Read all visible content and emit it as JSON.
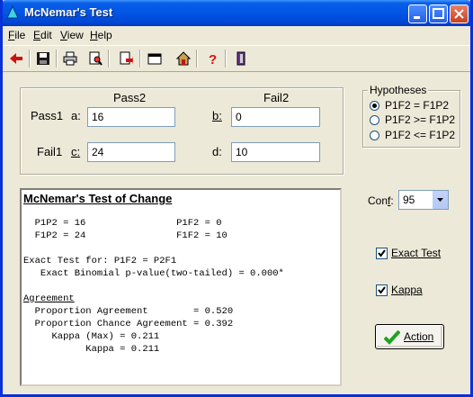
{
  "window": {
    "title": "McNemar's Test",
    "icon": "tree-icon"
  },
  "menu": [
    {
      "label": "File",
      "accel": "F"
    },
    {
      "label": "Edit",
      "accel": "E"
    },
    {
      "label": "View",
      "accel": "V"
    },
    {
      "label": "Help",
      "accel": "H"
    }
  ],
  "toolbar": [
    "back-arrow-icon",
    "save-icon",
    "print-icon",
    "print-preview-icon",
    "export-icon",
    "window-icon",
    "home-icon",
    "help-icon",
    "exit-icon"
  ],
  "table": {
    "col1": "Pass2",
    "col2": "Fail2",
    "row1": "Pass1",
    "row2": "Fail1",
    "a_label": "a:",
    "a_value": "16",
    "b_label": "b:",
    "b_value": "0",
    "c_label": "c:",
    "c_value": "24",
    "d_label": "d:",
    "d_value": "10"
  },
  "hypotheses": {
    "title": "Hypotheses",
    "options": [
      "P1F2 = F1P2",
      "P1F2 >= F1P2",
      "P1F2 <= F1P2"
    ],
    "selected": 0
  },
  "output": {
    "heading": "McNemar's Test of Change",
    "lines": [
      "  P1P2 = 16                P1F2 = 0",
      "  F1P2 = 24                F1F2 = 10",
      "",
      "Exact Test for: P1F2 = P2F1",
      "   Exact Binomial p-value(two-tailed) = 0.000*",
      ""
    ],
    "agreement_heading": "Agreement",
    "agreement_lines": [
      "  Proportion Agreement        = 0.520",
      "  Proportion Chance Agreement = 0.392",
      "     Kappa (Max) = 0.211",
      "           Kappa = 0.211"
    ]
  },
  "conf": {
    "label": "Conf:",
    "value": "95"
  },
  "exact_test": {
    "label": "Exact Test",
    "checked": true
  },
  "kappa": {
    "label": "Kappa",
    "checked": true
  },
  "action": {
    "label": "Action"
  },
  "colors": {
    "titlebar": "#0055e5",
    "face": "#ece9d8",
    "check": "#21a121"
  }
}
